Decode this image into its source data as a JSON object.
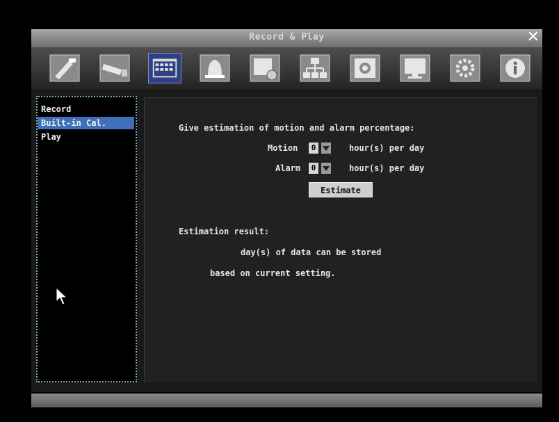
{
  "window": {
    "title": "Record & Play"
  },
  "toolbar": {
    "icons": [
      "camera-setup-icon",
      "camera-icon",
      "calendar-icon",
      "alarm-bell-icon",
      "disk-icon",
      "network-icon",
      "record-icon",
      "display-icon",
      "settings-gear-icon",
      "info-icon"
    ],
    "active_index": 2
  },
  "sidebar": {
    "items": [
      {
        "label": "Record"
      },
      {
        "label": "Built-in Cal."
      },
      {
        "label": "Play"
      }
    ],
    "selected_index": 1
  },
  "calculator": {
    "prompt": "Give estimation of motion and alarm percentage:",
    "motion_label": "Motion",
    "motion_value": "0",
    "alarm_label": "Alarm",
    "alarm_value": "0",
    "unit": "hour(s) per day",
    "estimate_button": "Estimate",
    "result_heading": "Estimation result:",
    "result_line": "day(s) of data can be stored",
    "result_basis": "based on current setting."
  },
  "colors": {
    "selection": "#3f6fb6",
    "active_tool": "#2f3f86",
    "panel": "#212121"
  }
}
